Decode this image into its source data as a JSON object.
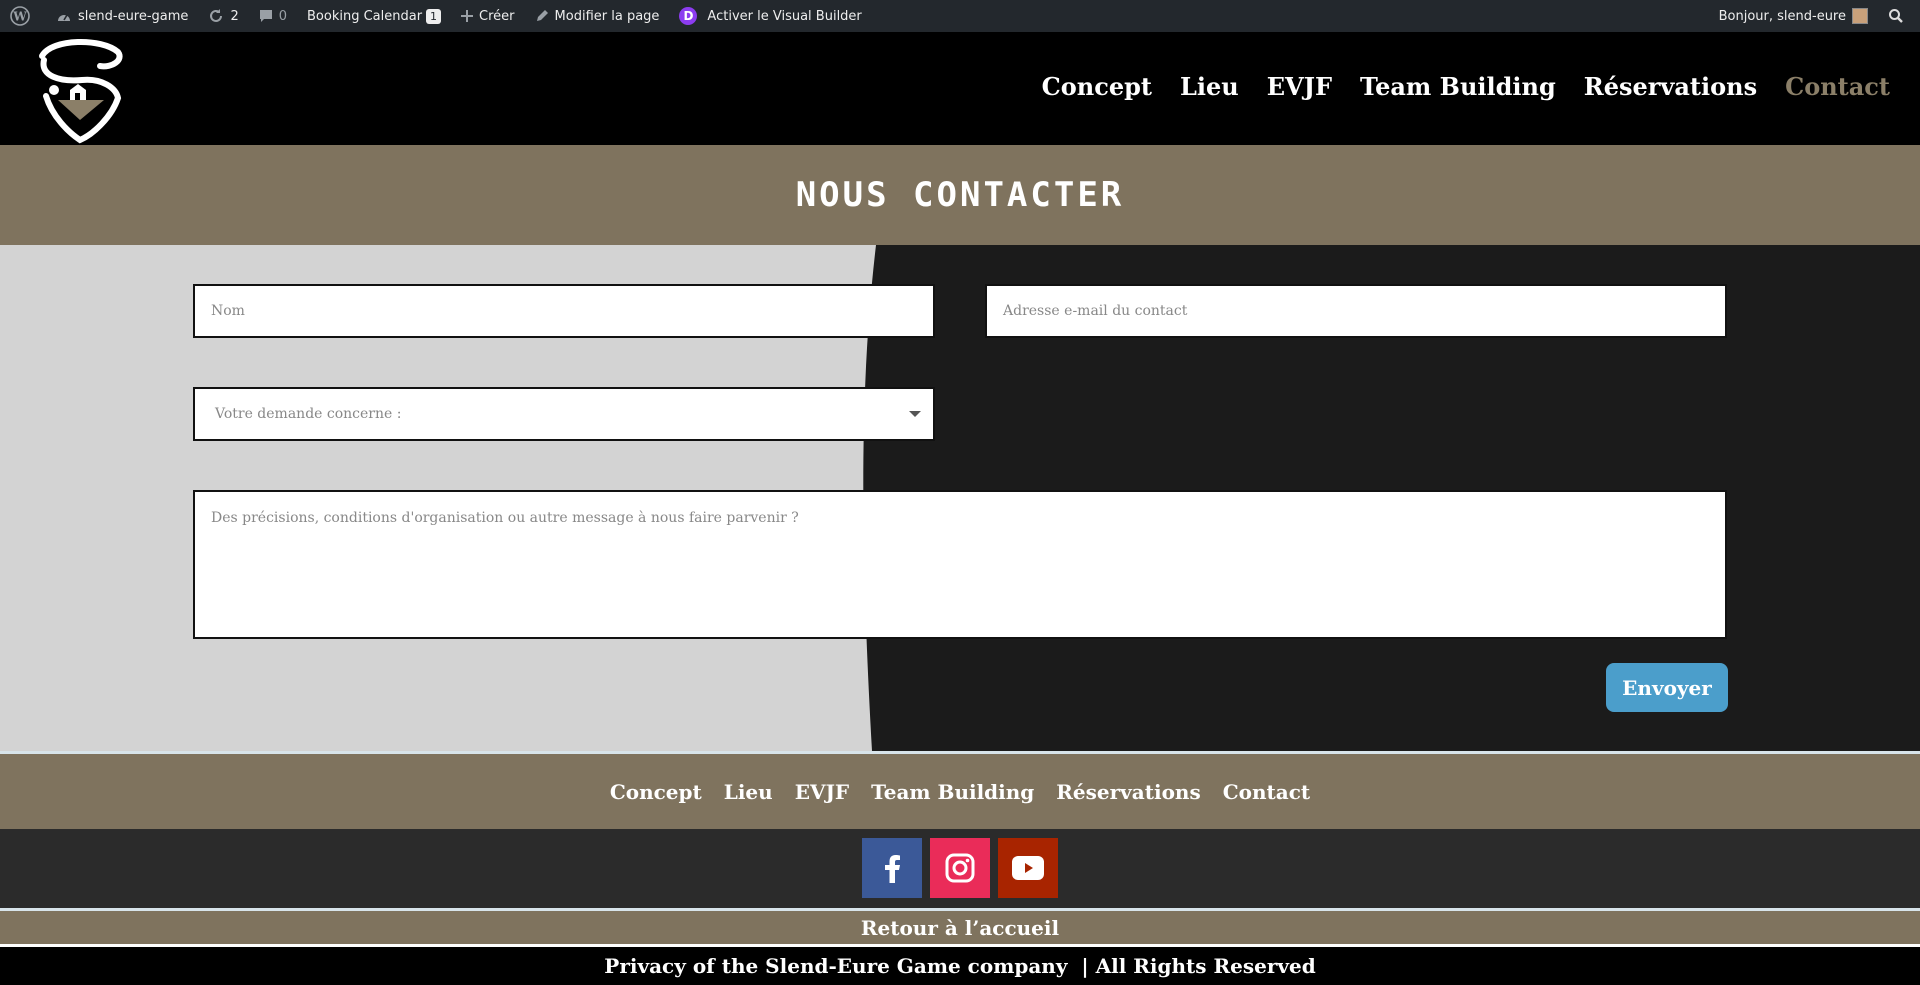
{
  "adminbar": {
    "site_name": "slend-eure-game",
    "updates_count": "2",
    "comments_count": "0",
    "booking_label": "Booking Calendar",
    "booking_count": "1",
    "create_label": "Créer",
    "edit_label": "Modifier la page",
    "visual_builder_label": "Activer le Visual Builder",
    "greeting": "Bonjour, slend-eure"
  },
  "nav": {
    "items": [
      "Concept",
      "Lieu",
      "EVJF",
      "Team Building",
      "Réservations",
      "Contact"
    ],
    "active": "Contact"
  },
  "page": {
    "title": "NOUS CONTACTER"
  },
  "form": {
    "name_placeholder": "Nom",
    "email_placeholder": "Adresse e-mail du contact",
    "topic_placeholder": "Votre demande concerne :",
    "message_placeholder": "Des précisions, conditions d'organisation ou autre message à nous faire parvenir ?",
    "submit_label": "Envoyer"
  },
  "footer": {
    "nav": [
      "Concept",
      "Lieu",
      "EVJF",
      "Team Building",
      "Réservations",
      "Contact"
    ],
    "social": [
      {
        "name": "facebook-icon",
        "color": "#3b5998"
      },
      {
        "name": "instagram-icon",
        "color": "#ea2c59"
      },
      {
        "name": "youtube-icon",
        "color": "#a82400"
      }
    ],
    "back_home": "Retour à l’accueil",
    "copyright": "Privacy of the Slend-Eure Game company  | All Rights Reserved"
  },
  "colors": {
    "header_bg": "#000000",
    "accent_taupe": "#7f735e",
    "active_link": "#8b7f68",
    "button_blue": "#4b9ecb"
  }
}
